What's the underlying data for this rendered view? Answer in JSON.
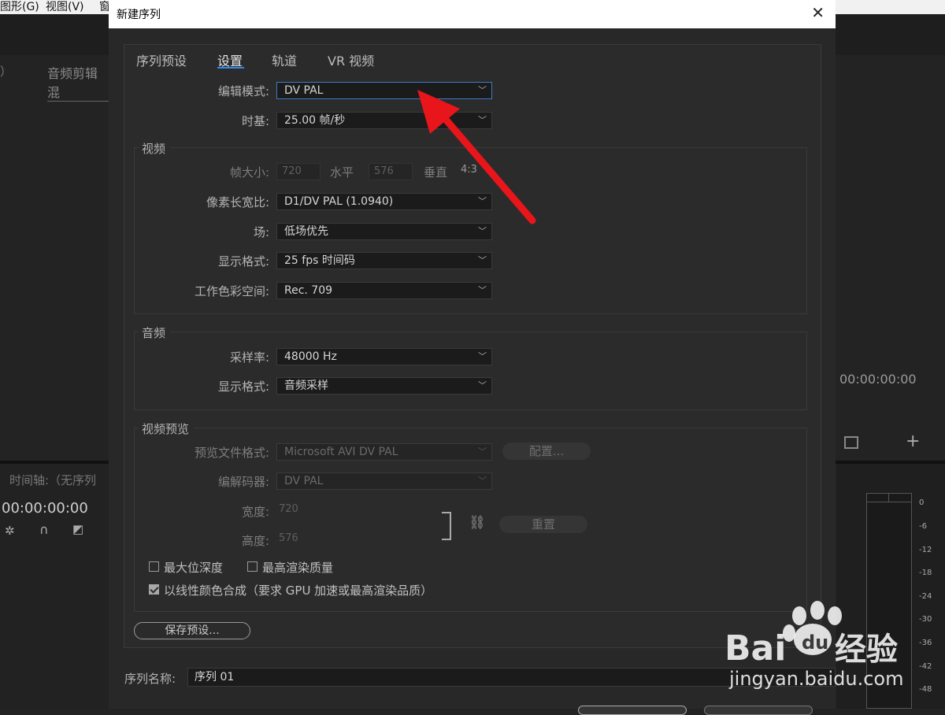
{
  "background": {
    "menu": [
      "图形(G)",
      "视图(V)",
      "窗"
    ],
    "left_panel_tab": "音频剪辑混",
    "timeline_label": "时间轴:（无序列",
    "timecode_left": "00:00:00:00",
    "timecode_right": "00:00:00:00",
    "meter_ticks": [
      "0",
      "-6",
      "-12",
      "-18",
      "-24",
      "-30",
      "-36",
      "-42",
      "-48"
    ]
  },
  "dialog": {
    "title": "新建序列",
    "tabs": [
      "序列预设",
      "设置",
      "轨道",
      "VR 视频"
    ],
    "active_tab": "设置",
    "edit_mode": {
      "label": "编辑模式:",
      "value": "DV PAL"
    },
    "timebase": {
      "label": "时基:",
      "value": "25.00  帧/秒"
    },
    "video": {
      "title": "视频",
      "frame_size_label": "帧大小:",
      "frame_width": "720",
      "horizontal_label": "水平",
      "frame_height": "576",
      "vertical_label": "垂直",
      "aspect": "4:3",
      "pixel_aspect": {
        "label": "像素长宽比:",
        "value": "D1/DV PAL (1.0940)"
      },
      "fields": {
        "label": "场:",
        "value": "低场优先"
      },
      "display_format": {
        "label": "显示格式:",
        "value": "25 fps 时间码"
      },
      "color_space": {
        "label": "工作色彩空间:",
        "value": "Rec. 709"
      }
    },
    "audio": {
      "title": "音频",
      "sample_rate": {
        "label": "采样率:",
        "value": "48000 Hz"
      },
      "display_format": {
        "label": "显示格式:",
        "value": "音频采样"
      }
    },
    "preview": {
      "title": "视频预览",
      "file_format": {
        "label": "预览文件格式:",
        "value": "Microsoft AVI DV PAL"
      },
      "config_label": "配置...",
      "codec": {
        "label": "编解码器:",
        "value": "DV PAL"
      },
      "width_label": "宽度:",
      "width_value": "720",
      "height_label": "高度:",
      "height_value": "576",
      "reset_label": "重置"
    },
    "max_bit_depth": {
      "label": "最大位深度",
      "checked": false
    },
    "max_render_quality": {
      "label": "最高渲染质量",
      "checked": false
    },
    "linear_color": {
      "label": "以线性颜色合成（要求 GPU 加速或最高渲染品质）",
      "checked": true
    },
    "save_preset_label": "保存预设...",
    "sequence_name": {
      "label": "序列名称:",
      "value": "序列 01"
    }
  },
  "watermark": {
    "brand_a": "Bai",
    "brand_b": "du",
    "brand_c": "经验",
    "url": "jingyan.baidu.com"
  },
  "colors": {
    "accent": "#2d8ceb",
    "arrow": "#e8151b"
  }
}
